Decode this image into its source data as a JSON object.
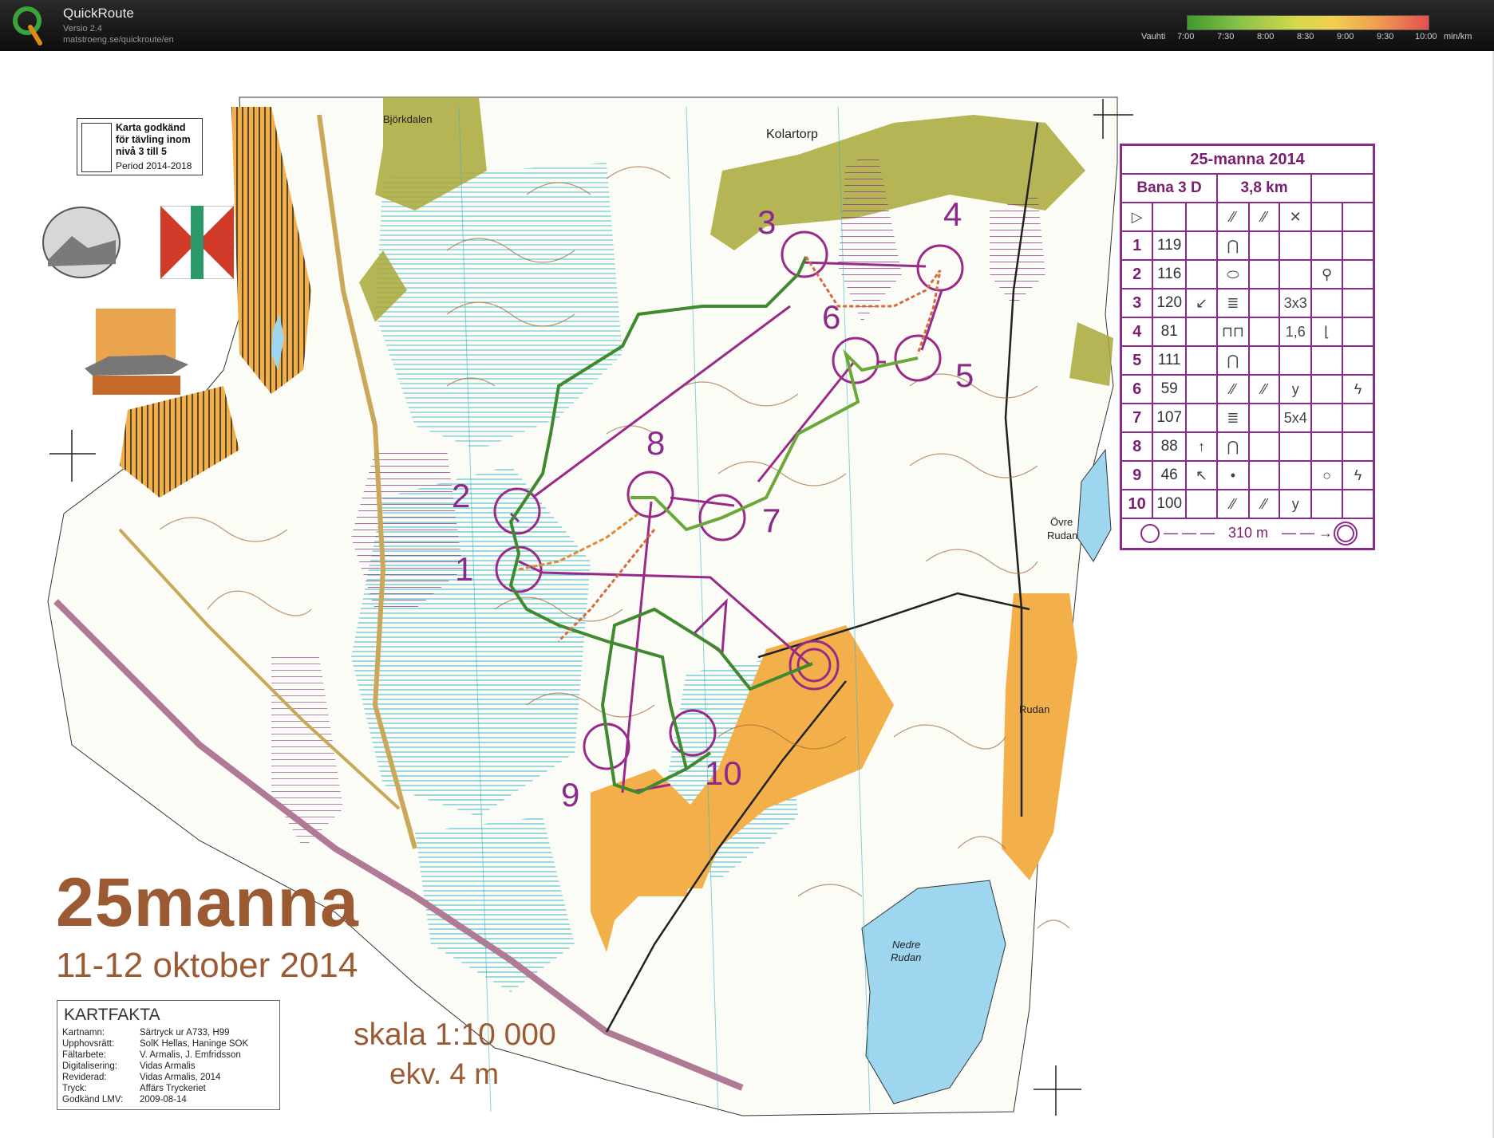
{
  "app": {
    "title": "QuickRoute",
    "version": "Versio 2.4",
    "url": "matstroeng.se/quickroute/en",
    "logo_icon": "quickroute-q-icon"
  },
  "pace_legend": {
    "label": "Vauhti",
    "ticks": [
      "7:00",
      "7:30",
      "8:00",
      "8:30",
      "9:00",
      "9:30",
      "10:00"
    ],
    "unit": "min/km",
    "colors": [
      "#3f9a2e",
      "#8bc34a",
      "#d4d84a",
      "#f0d050",
      "#f0a050",
      "#e45050"
    ]
  },
  "approval": {
    "text_lines": [
      "Karta godkänd",
      "för tävling inom",
      "nivå 3 till 5"
    ],
    "period": "Period 2014-2018"
  },
  "event": {
    "title": "25manna",
    "dates": "11-12 oktober 2014",
    "scale": "skala 1:10 000",
    "equidistance": "ekv. 4 m",
    "logo_text": "manna",
    "logo_number": "25"
  },
  "kartfakta": {
    "heading": "KARTFAKTA",
    "rows": [
      {
        "key": "Kartnamn:",
        "value": "Särtryck ur  A733, H99"
      },
      {
        "key": "Upphovsrätt:",
        "value": "SolK Hellas, Haninge SOK"
      },
      {
        "key": "Fältarbete:",
        "value": "V. Armalis, J. Emfridsson"
      },
      {
        "key": "Digitalisering:",
        "value": "Vidas Armalis"
      },
      {
        "key": "Reviderad:",
        "value": "Vidas Armalis, 2014"
      },
      {
        "key": "Tryck:",
        "value": "Affärs Tryckeriet"
      },
      {
        "key": "Godkänd LMV:",
        "value": "2009-08-14"
      }
    ]
  },
  "place_names": {
    "bjorkdalen": "Björkdalen",
    "kolartorp": "Kolartorp",
    "ovre_rudan_1": "Övre",
    "ovre_rudan_2": "Rudan",
    "rudan": "Rudan",
    "nedre_rudan_1": "Nedre",
    "nedre_rudan_2": "Rudan"
  },
  "control_description": {
    "title": "25-manna 2014",
    "course": "Bana 3 D",
    "length": "3,8 km",
    "rows": [
      {
        "num": "1",
        "code": "119",
        "c": "",
        "d": "⋂",
        "e": "",
        "f": "",
        "g": "",
        "h": ""
      },
      {
        "num": "2",
        "code": "116",
        "c": "",
        "d": "⬭",
        "e": "",
        "f": "",
        "g": "⚲",
        "h": ""
      },
      {
        "num": "3",
        "code": "120",
        "c": "↙",
        "d": "≣",
        "e": "",
        "f": "3x3",
        "g": "",
        "h": ""
      },
      {
        "num": "4",
        "code": "81",
        "c": "",
        "d": "⊓⊓",
        "e": "",
        "f": "1,6",
        "g": "⌊",
        "h": ""
      },
      {
        "num": "5",
        "code": "111",
        "c": "",
        "d": "⋂",
        "e": "",
        "f": "",
        "g": "",
        "h": ""
      },
      {
        "num": "6",
        "code": "59",
        "c": "",
        "d": "⁄⁄",
        "e": "⁄⁄",
        "f": "y",
        "g": "",
        "h": "ϟ"
      },
      {
        "num": "7",
        "code": "107",
        "c": "",
        "d": "≣",
        "e": "",
        "f": "5x4",
        "g": "",
        "h": ""
      },
      {
        "num": "8",
        "code": "88",
        "c": "↑",
        "d": "⋂",
        "e": "",
        "f": "",
        "g": "",
        "h": ""
      },
      {
        "num": "9",
        "code": "46",
        "c": "↖",
        "d": "•",
        "e": "",
        "f": "",
        "g": "○",
        "h": "ϟ"
      },
      {
        "num": "10",
        "code": "100",
        "c": "",
        "d": "⁄⁄",
        "e": "⁄⁄",
        "f": "y",
        "g": "",
        "h": ""
      }
    ],
    "finish_distance": "310 m",
    "header_symbols": [
      "▷",
      "⁄⁄",
      "⁄⁄",
      "✕"
    ]
  },
  "controls_on_map": [
    "1",
    "2",
    "3",
    "4",
    "5",
    "6",
    "7",
    "8",
    "9",
    "10"
  ]
}
